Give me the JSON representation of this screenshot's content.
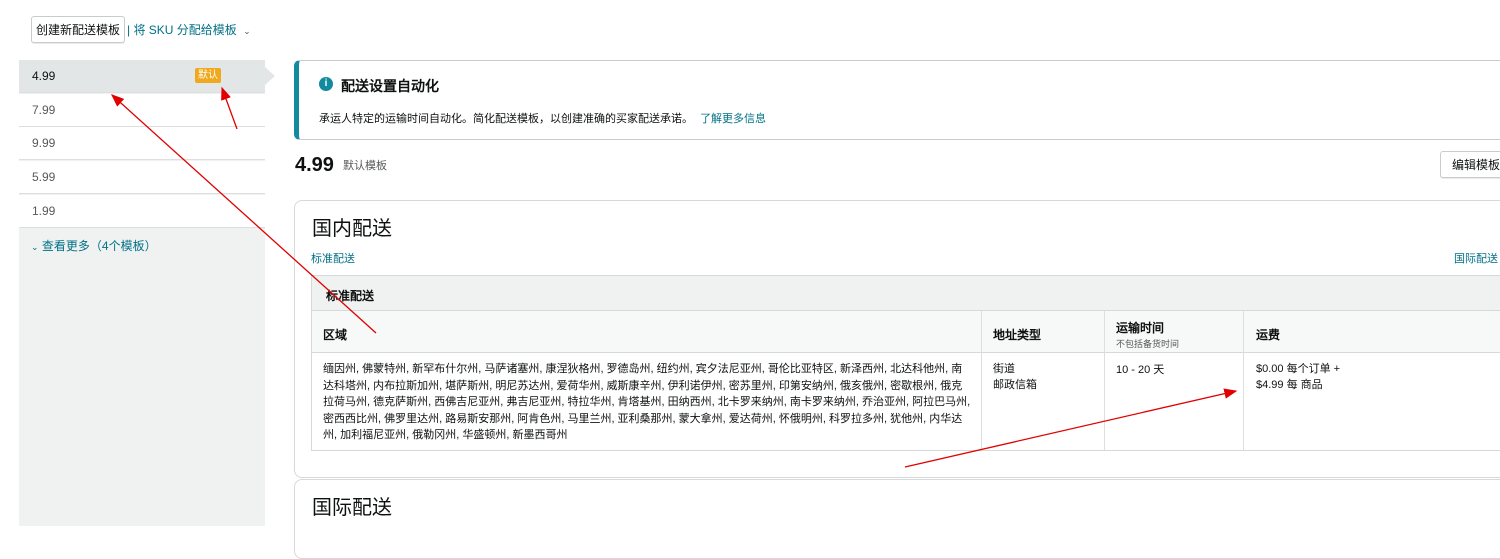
{
  "toolbar": {
    "create_label": "创建新配送模板",
    "assign_label": "| 将 SKU 分配给模板"
  },
  "sidebar": {
    "items": [
      {
        "label": "4.99",
        "badge": "默认"
      },
      {
        "label": "7.99"
      },
      {
        "label": "9.99"
      },
      {
        "label": "5.99"
      },
      {
        "label": "1.99"
      }
    ],
    "more_label": "查看更多（4个模板）"
  },
  "info": {
    "icon": "info-icon",
    "title": "配送设置自动化",
    "body": "承运人特定的运输时间自动化。简化配送模板，以创建准确的买家配送承诺。",
    "link": "了解更多信息"
  },
  "template": {
    "name": "4.99",
    "subtitle": "默认模板",
    "edit_label": "编辑模板"
  },
  "domestic": {
    "heading": "国内配送",
    "tab_standard": "标准配送",
    "tab_international": "国际配送",
    "section_title": "标准配送",
    "columns": {
      "region": "区域",
      "address_type": "地址类型",
      "transit_time": "运输时间",
      "transit_note": "不包括备货时间",
      "fee": "运费"
    },
    "row": {
      "region": "缅因州, 佛蒙特州, 新罕布什尔州, 马萨诸塞州, 康涅狄格州, 罗德岛州, 纽约州, 宾夕法尼亚州, 哥伦比亚特区, 新泽西州, 北达科他州, 南达科塔州, 内布拉斯加州, 堪萨斯州, 明尼苏达州, 爱荷华州, 威斯康辛州, 伊利诺伊州, 密苏里州, 印第安纳州, 俄亥俄州, 密歇根州, 俄克拉荷马州, 德克萨斯州, 西佛吉尼亚州, 弗吉尼亚州, 特拉华州, 肯塔基州, 田纳西州, 北卡罗来纳州, 南卡罗来纳州, 乔治亚州, 阿拉巴马州, 密西西比州, 佛罗里达州, 路易斯安那州, 阿肯色州, 马里兰州, 亚利桑那州, 蒙大拿州, 爱达荷州, 怀俄明州, 科罗拉多州, 犹他州, 内华达州, 加利福尼亚州, 俄勒冈州, 华盛顿州, 新墨西哥州",
      "address_line1": "街道",
      "address_line2": "邮政信箱",
      "transit": "10 - 20 天",
      "fee_line1": "$0.00 每个订单 +",
      "fee_line2": "$4.99 每 商品"
    }
  },
  "international": {
    "heading": "国际配送"
  },
  "colors": {
    "link": "#007185",
    "badge": "#f0a81c",
    "info_accent": "#138b9e",
    "annotation": "#e00000"
  }
}
